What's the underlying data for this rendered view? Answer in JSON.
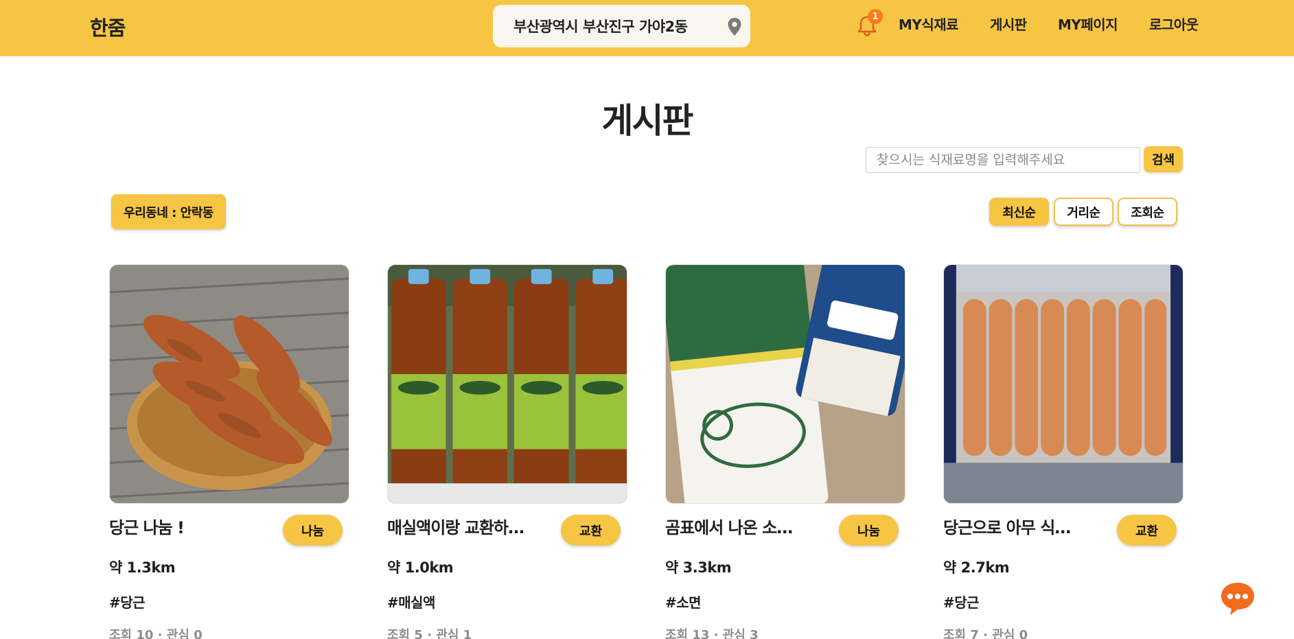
{
  "header": {
    "logo": "한줌",
    "location": "부산광역시 부산진구 가야2동",
    "notification_count": "1",
    "nav": [
      "MY식재료",
      "게시판",
      "MY페이지",
      "로그아웃"
    ]
  },
  "main": {
    "title": "게시판",
    "search": {
      "placeholder": "찾으시는 식재료명을 입력해주세요",
      "button": "검색"
    },
    "neighborhood": "우리동네 : 안락동",
    "sort": {
      "options": [
        "최신순",
        "거리순",
        "조회순"
      ],
      "active": "최신순"
    }
  },
  "posts": [
    {
      "title": "당근 나눔 !",
      "type": "나눔",
      "distance": "약 1.3km",
      "tag": "#당근",
      "stats": "조회 10 · 관심 0",
      "image": "carrots-basket"
    },
    {
      "title": "매실액이랑 교환하…",
      "type": "교환",
      "distance": "약 1.0km",
      "tag": "#매실액",
      "stats": "조회 5 · 관심 1",
      "image": "plum-syrup-bottles"
    },
    {
      "title": "곰표에서 나온 소…",
      "type": "나눔",
      "distance": "약 3.3km",
      "tag": "#소면",
      "stats": "조회 13 · 관심 3",
      "image": "noodle-package"
    },
    {
      "title": "당근으로 아무 식…",
      "type": "교환",
      "distance": "약 2.7km",
      "tag": "#당근",
      "stats": "조회 7 · 관심 0",
      "image": "carrots-box"
    }
  ],
  "colors": {
    "brand": "#f7c544",
    "badge": "#ff7a1a",
    "chat": "#f26b1d"
  },
  "icons": {
    "location": "map-pin-icon",
    "notification": "bell-icon",
    "chat": "chat-bubble-icon"
  }
}
